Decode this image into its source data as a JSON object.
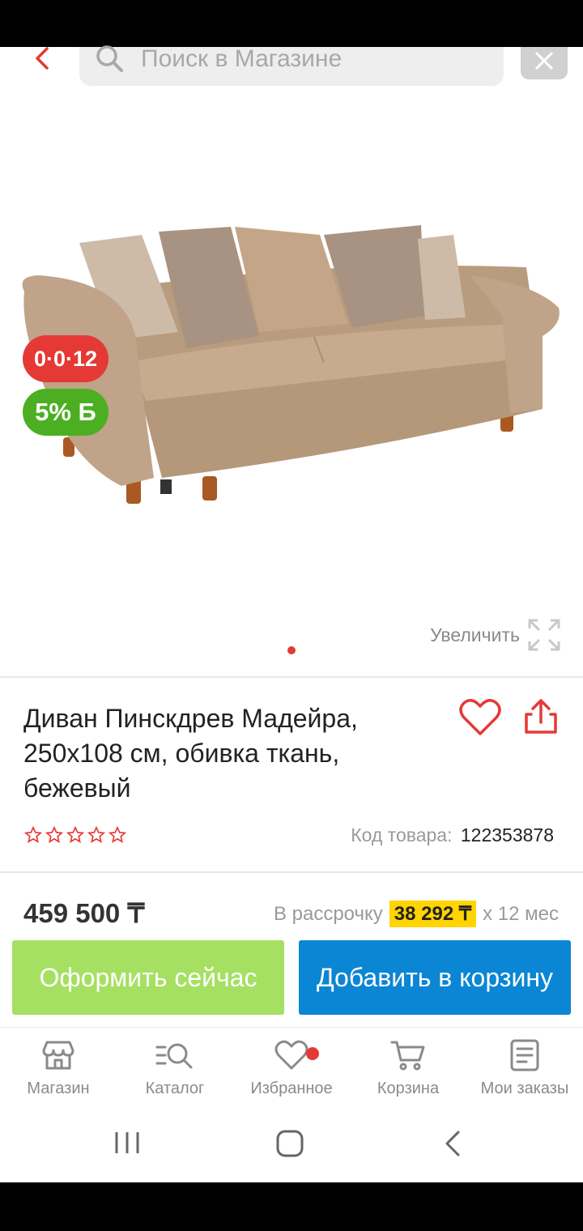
{
  "search": {
    "placeholder": "Поиск в Магазине"
  },
  "badges": {
    "installment": "0·0·12",
    "bonus": "5% Б"
  },
  "gallery": {
    "zoom_label": "Увеличить"
  },
  "product": {
    "title": "Диван Пинскдрев Мадейра, 250x108 см, обивка ткань, бежевый",
    "rating_stars": 5,
    "sku_label": "Код товара:",
    "sku_value": "122353878",
    "price": "459 500 ₸",
    "installment_prefix": "В рассрочку",
    "installment_amount": "38 292 ₸",
    "installment_suffix": "x 12 мес"
  },
  "actions": {
    "buy_now": "Оформить сейчас",
    "add_to_cart": "Добавить в корзину"
  },
  "nav": {
    "items": [
      {
        "label": "Магазин",
        "icon": "store-icon"
      },
      {
        "label": "Каталог",
        "icon": "catalog-search-icon"
      },
      {
        "label": "Избранное",
        "icon": "heart-icon"
      },
      {
        "label": "Корзина",
        "icon": "cart-icon"
      },
      {
        "label": "Мои заказы",
        "icon": "orders-icon"
      }
    ]
  },
  "colors": {
    "accent_red": "#e53935",
    "bonus_green": "#4caf22",
    "buy_green": "#a6e063",
    "cart_blue": "#0b86d4",
    "installment_yellow": "#ffd400"
  }
}
